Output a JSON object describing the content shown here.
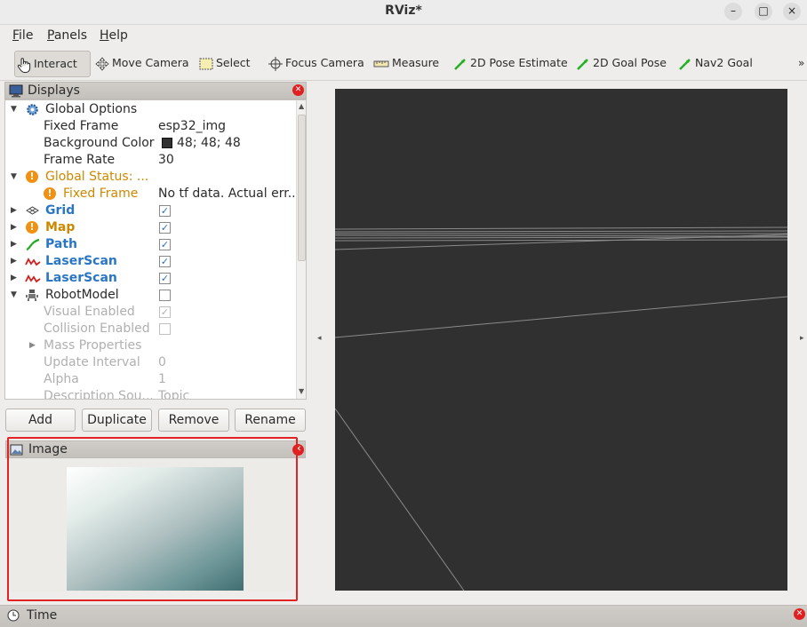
{
  "window": {
    "title": "RViz*",
    "min": "–",
    "max": "□",
    "close": "×"
  },
  "menu": [
    {
      "label": "File"
    },
    {
      "label": "Panels"
    },
    {
      "label": "Help"
    }
  ],
  "toolbar": {
    "tools": [
      "Interact",
      "Move Camera",
      "Select",
      "Focus Camera",
      "Measure",
      "2D Pose Estimate",
      "2D Goal Pose",
      "Nav2 Goal"
    ],
    "overflow": "»"
  },
  "displays": {
    "title": "Displays",
    "rows": [
      {
        "name": "Global Options",
        "value": ""
      },
      {
        "name": "Fixed Frame",
        "value": "esp32_img"
      },
      {
        "name": "Background Color",
        "value": "48; 48; 48"
      },
      {
        "name": "Frame Rate",
        "value": "30"
      },
      {
        "name": "Global Status: ...",
        "value": ""
      },
      {
        "name": "Fixed Frame",
        "value": "No tf data.  Actual err..."
      },
      {
        "name": "Grid",
        "checked": true
      },
      {
        "name": "Map",
        "checked": true
      },
      {
        "name": "Path",
        "checked": true
      },
      {
        "name": "LaserScan",
        "checked": true
      },
      {
        "name": "LaserScan",
        "checked": true
      },
      {
        "name": "RobotModel",
        "checked": false
      },
      {
        "name": "Visual Enabled",
        "checked": true
      },
      {
        "name": "Collision Enabled",
        "checked": false
      },
      {
        "name": "Mass Properties",
        "value": ""
      },
      {
        "name": "Update Interval",
        "value": "0"
      },
      {
        "name": "Alpha",
        "value": "1"
      },
      {
        "name": "Description Sou...",
        "value": "Topic"
      }
    ],
    "bg_swatch": "#303030"
  },
  "buttons": {
    "add": "Add",
    "duplicate": "Duplicate",
    "remove": "Remove",
    "rename": "Rename"
  },
  "image_panel": {
    "title": "Image"
  },
  "time_panel": {
    "title": "Time"
  },
  "viewport": {
    "background": "#303030",
    "grid_color": "#8a8a8a",
    "left_arrow": "◂",
    "right_arrow": "▸"
  },
  "colors": {
    "highlight_box": "#e32323",
    "status_warn": "#f29111",
    "link_blue": "#2a76c6"
  }
}
